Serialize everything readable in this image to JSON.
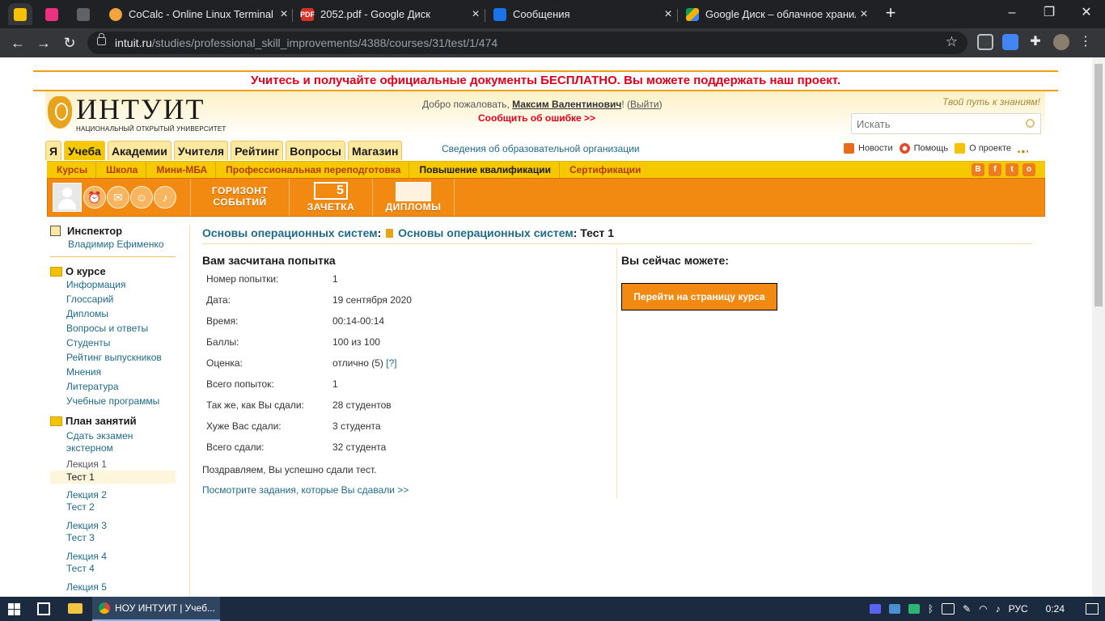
{
  "browser": {
    "tabs": [
      {
        "title": "CoCalc - Online Linux Terminal",
        "icon": "cocalc-icon"
      },
      {
        "title": "2052.pdf - Google Диск",
        "icon": "pdf-icon",
        "badge": "PDF"
      },
      {
        "title": "Сообщения",
        "icon": "messages-icon"
      },
      {
        "title": "Google Диск – облачное хранил",
        "icon": "google-drive-icon"
      }
    ],
    "url_domain": "intuit.ru",
    "url_path": "/studies/professional_skill_improvements/4388/courses/31/test/1/474"
  },
  "banner": "Учитесь и получайте официальные документы БЕСПЛАТНО. Вы можете поддержать наш проект.",
  "header": {
    "logo_title": "ИНТУИТ",
    "logo_subtitle": "НАЦИОНАЛЬНЫЙ ОТКРЫТЫЙ УНИВЕРСИТЕТ",
    "welcome_prefix": "Добро пожаловать,",
    "user_name": "Максим Валентинович",
    "welcome_sep": "!",
    "logout_label": "Выйти",
    "report_error": "Сообщить об ошибке >>",
    "slogan": "Твой путь к знаниям!",
    "search_placeholder": "Искать"
  },
  "main_tabs": [
    "Я",
    "Учеба",
    "Академии",
    "Учителя",
    "Рейтинг",
    "Вопросы",
    "Магазин"
  ],
  "org_info_link": "Сведения об образовательной организации",
  "top_links": [
    {
      "label": "Новости",
      "icon": "rss-icon"
    },
    {
      "label": "Помощь",
      "icon": "lifebuoy-icon"
    },
    {
      "label": "О проекте",
      "icon": "info-icon"
    },
    {
      "label": "",
      "icon": "sitemap-icon"
    }
  ],
  "sub_nav": [
    "Курсы",
    "Школа",
    "Мини-МБА",
    "Профессиональная переподготовка",
    "Повышение квалификации",
    "Сертификации"
  ],
  "social_icons": [
    "vk-icon",
    "facebook-icon",
    "twitter-icon",
    "odnoklassniki-icon"
  ],
  "orange_bar": {
    "horizon_line1": "ГОРИЗОНТ",
    "horizon_line2": "СОБЫТИЙ",
    "zachetka_label": "ЗАЧЕТКА",
    "zachetka_mark": "5",
    "diplomas_label": "ДИПЛОМЫ"
  },
  "sidebar": {
    "inspector_title": "Инспектор",
    "inspector_name": "Владимир Ефименко",
    "about_title": "О курсе",
    "about_links": [
      "Информация",
      "Глоссарий",
      "Дипломы",
      "Вопросы и ответы",
      "Студенты",
      "Рейтинг выпускников",
      "Мнения",
      "Литература",
      "Учебные программы"
    ],
    "plan_title": "План занятий",
    "plan_exam": "Сдать экзамен экстерном",
    "lecture1": "Лекция 1",
    "test1": "Тест 1",
    "lecture2": "Лекция 2",
    "test2": "Тест 2",
    "lecture3": "Лекция 3",
    "test3": "Тест 3",
    "lecture4": "Лекция 4",
    "test4": "Тест 4",
    "lecture5": "Лекция 5"
  },
  "breadcrumb": {
    "course1": "Основы операционных систем",
    "sep1": ":",
    "course2": "Основы операционных систем",
    "sep2": ":",
    "current": "Тест 1"
  },
  "result": {
    "title": "Вам засчитана попытка",
    "rows": [
      {
        "label": "Номер попытки:",
        "value": "1"
      },
      {
        "label": "Дата:",
        "value": "19 сентября 2020"
      },
      {
        "label": "Время:",
        "value": "00:14-00:14"
      },
      {
        "label": "Баллы:",
        "value": "100 из 100"
      },
      {
        "label": "Оценка:",
        "value": "отлично (5)",
        "help": "[?]"
      },
      {
        "label": "Всего попыток:",
        "value": "1"
      },
      {
        "label": "Так же, как Вы сдали:",
        "value": "28 студентов"
      },
      {
        "label": "Хуже Вас сдали:",
        "value": "3 студента"
      },
      {
        "label": "Всего сдали:",
        "value": "32 студента"
      }
    ],
    "congrats": "Поздравляем, Вы успешно сдали тест.",
    "view_tasks": "Посмотрите задания, которые Вы сдавали >>"
  },
  "actions": {
    "title": "Вы сейчас можете:",
    "go_course_button": "Перейти на страницу курса"
  },
  "taskbar": {
    "app_title": "НОУ ИНТУИТ | Учеб...",
    "language": "РУС",
    "time": "0:24"
  },
  "colors": {
    "brand_orange": "#f28a11",
    "brand_yellow": "#f6c800",
    "link_blue": "#1e6b8c",
    "alert_red": "#e3001b"
  }
}
